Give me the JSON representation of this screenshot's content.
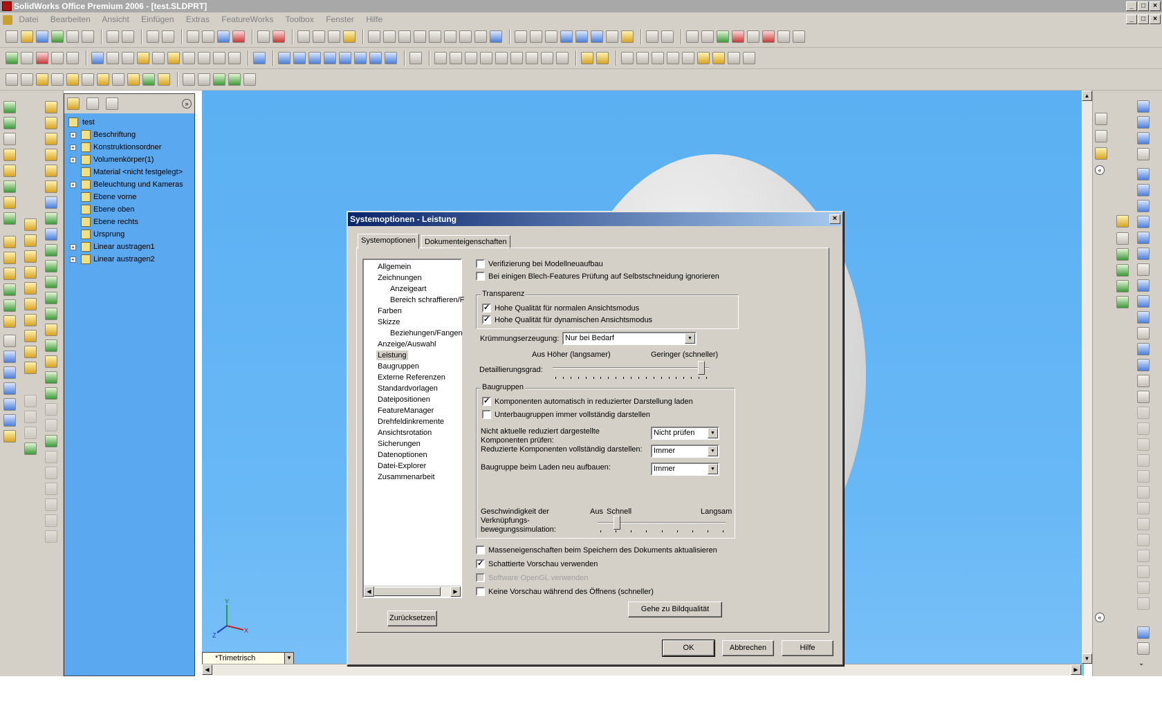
{
  "window": {
    "title": "SolidWorks Office Premium 2006 - [test.SLDPRT]"
  },
  "menu": [
    "Datei",
    "Bearbeiten",
    "Ansicht",
    "Einfügen",
    "Extras",
    "FeatureWorks",
    "Toolbox",
    "Fenster",
    "Hilfe"
  ],
  "feature_manager": {
    "items": [
      {
        "label": "test",
        "icon": "part-icon",
        "expandable": false
      },
      {
        "label": "Beschriftung",
        "icon": "annotation-icon",
        "expandable": true
      },
      {
        "label": "Konstruktionsordner",
        "icon": "folder-icon",
        "expandable": true
      },
      {
        "label": "Volumenkörper(1)",
        "icon": "solid-bodies-icon",
        "expandable": true
      },
      {
        "label": "Material <nicht festgelegt>",
        "icon": "material-icon",
        "expandable": false
      },
      {
        "label": "Beleuchtung und Kameras",
        "icon": "lighting-icon",
        "expandable": true
      },
      {
        "label": "Ebene vorne",
        "icon": "plane-icon",
        "expandable": false
      },
      {
        "label": "Ebene oben",
        "icon": "plane-icon",
        "expandable": false
      },
      {
        "label": "Ebene rechts",
        "icon": "plane-icon",
        "expandable": false
      },
      {
        "label": "Ursprung",
        "icon": "origin-icon",
        "expandable": false
      },
      {
        "label": "Linear austragen1",
        "icon": "extrude-icon",
        "expandable": true
      },
      {
        "label": "Linear austragen2",
        "icon": "extrude-icon",
        "expandable": true
      }
    ]
  },
  "viewport": {
    "view_orientation": "*Trimetrisch",
    "triad": {
      "x": "X",
      "y": "Y",
      "z": "Z"
    }
  },
  "dialog": {
    "title": "Systemoptionen - Leistung",
    "tabs": [
      "Systemoptionen",
      "Dokumenteigenschaften"
    ],
    "active_tab": "Systemoptionen",
    "tree": [
      {
        "label": "Allgemein",
        "indent": 0
      },
      {
        "label": "Zeichnungen",
        "indent": 0
      },
      {
        "label": "Anzeigeart",
        "indent": 1
      },
      {
        "label": "Bereich schraffieren/F",
        "indent": 1
      },
      {
        "label": "Farben",
        "indent": 0
      },
      {
        "label": "Skizze",
        "indent": 0
      },
      {
        "label": "Beziehungen/Fangen",
        "indent": 1
      },
      {
        "label": "Anzeige/Auswahl",
        "indent": 0
      },
      {
        "label": "Leistung",
        "indent": 0,
        "selected": true
      },
      {
        "label": "Baugruppen",
        "indent": 0
      },
      {
        "label": "Externe Referenzen",
        "indent": 0
      },
      {
        "label": "Standardvorlagen",
        "indent": 0
      },
      {
        "label": "Dateipositionen",
        "indent": 0
      },
      {
        "label": "FeatureManager",
        "indent": 0
      },
      {
        "label": "Drehfeldinkremente",
        "indent": 0
      },
      {
        "label": "Ansichtsrotation",
        "indent": 0
      },
      {
        "label": "Sicherungen",
        "indent": 0
      },
      {
        "label": "Datenoptionen",
        "indent": 0
      },
      {
        "label": "Datei-Explorer",
        "indent": 0
      },
      {
        "label": "Zusammenarbeit",
        "indent": 0
      }
    ],
    "reset_button": "Zurücksetzen",
    "options": {
      "verify_rebuild": {
        "label": "Verifizierung bei Modellneuaufbau",
        "checked": false
      },
      "ignore_sheetmetal": {
        "label": "Bei einigen Blech-Features Prüfung auf Selbstschneidung ignorieren",
        "checked": false
      },
      "transparency_group": "Transparenz",
      "hq_normal": {
        "label": "Hohe Qualität für normalen Ansichtsmodus",
        "checked": true
      },
      "hq_dynamic": {
        "label": "Hohe Qualität für dynamischen Ansichtsmodus",
        "checked": true
      },
      "curvature_label": "Krümmungserzeugung:",
      "curvature_value": "Nur bei Bedarf",
      "detail_label": "Detaillierungsgrad:",
      "detail_left": "Aus Höher (langsamer)",
      "detail_right": "Geringer (schneller)",
      "detail_level": 0.95,
      "assemblies_group": "Baugruppen",
      "auto_load_reduced": {
        "label": "Komponenten automatisch in reduzierter Darstellung laden",
        "checked": true
      },
      "subassemblies_full": {
        "label": "Unterbaugruppen immer vollständig darstellen",
        "checked": false
      },
      "check_outdated_label1": "Nicht aktuelle reduziert dargestellte",
      "check_outdated_label2": "Komponenten prüfen:",
      "check_outdated_value": "Nicht prüfen",
      "resolve_label": "Reduzierte Komponenten vollständig darstellen:",
      "resolve_value": "Immer",
      "rebuild_label": "Baugruppe beim Laden neu aufbauen:",
      "rebuild_value": "Immer",
      "mate_speed_label1": "Geschwindigkeit der",
      "mate_speed_label2": "Verknüpfungs-",
      "mate_speed_label3": "bewegungssimulation:",
      "mate_speed_off": "Aus",
      "mate_speed_fast": "Schnell",
      "mate_speed_slow": "Langsam",
      "mate_speed_level": 0.15,
      "mass_props": {
        "label": "Masseneigenschaften beim Speichern des Dokuments aktualisieren",
        "checked": false
      },
      "shaded_preview": {
        "label": "Schattierte Vorschau verwenden",
        "checked": true
      },
      "software_opengl": {
        "label": "Software OpenGL verwenden",
        "checked": false,
        "disabled": true
      },
      "no_preview": {
        "label": "Keine Vorschau während des Öffnens (schneller)",
        "checked": false
      },
      "image_quality_button": "Gehe zu Bildqualität"
    },
    "buttons": {
      "ok": "OK",
      "cancel": "Abbrechen",
      "help": "Hilfe"
    }
  },
  "colors": {
    "title_active": "#0a246a",
    "viewport_blue": "#5ab0f2",
    "chrome": "#d4d0c8"
  }
}
